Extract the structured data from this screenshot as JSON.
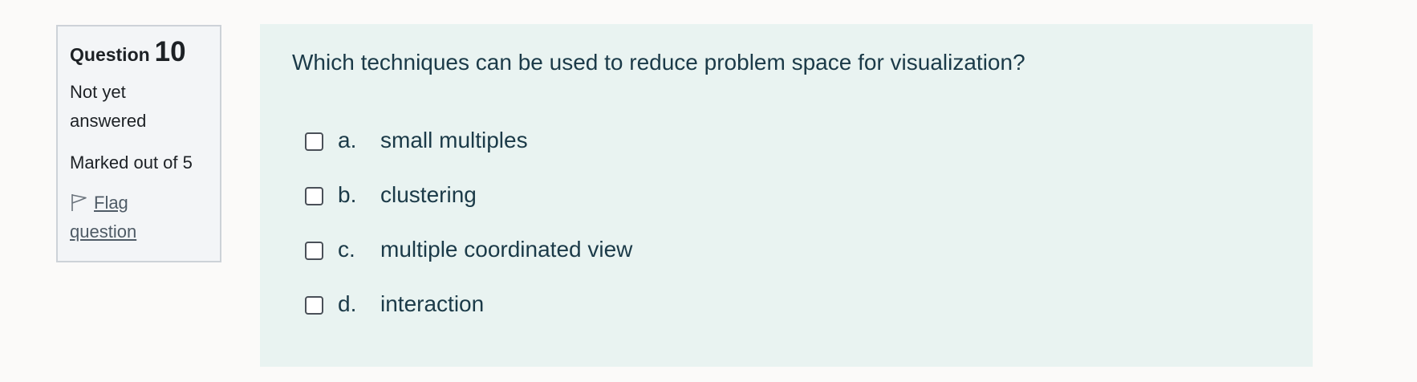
{
  "question_info": {
    "question_label": "Question",
    "question_number": "10",
    "state": "Not yet answered",
    "grade": "Marked out of 5",
    "flag_label": "Flag question"
  },
  "question": {
    "text": "Which techniques can be used to reduce problem space for visualization?",
    "answers": [
      {
        "letter": "a.",
        "text": "small multiples",
        "checked": false
      },
      {
        "letter": "b.",
        "text": "clustering",
        "checked": false
      },
      {
        "letter": "c.",
        "text": "multiple coordinated view",
        "checked": false
      },
      {
        "letter": "d.",
        "text": "interaction",
        "checked": false
      }
    ]
  },
  "colors": {
    "page_background": "#fbfaf9",
    "info_background": "#f3f5f7",
    "content_background": "#e9f3f1",
    "question_text": "#1b3a48",
    "link": "#4f5b66"
  },
  "icons": {
    "flag": "flag-outline-icon"
  }
}
